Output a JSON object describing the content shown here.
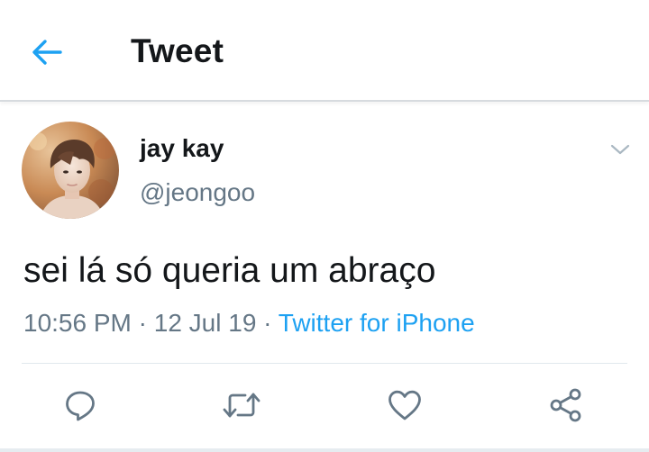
{
  "header": {
    "title": "Tweet",
    "back_icon": "arrow-left-icon"
  },
  "tweet": {
    "author_name": "jay kay",
    "author_handle": "@jeongoo",
    "text": "sei lá só queria um abraço",
    "time": "10:56 PM",
    "date": "12 Jul 19",
    "separator": "·",
    "source": "Twitter for iPhone",
    "more_icon": "chevron-down-icon"
  },
  "actions": [
    {
      "name": "reply",
      "icon": "reply-icon"
    },
    {
      "name": "retweet",
      "icon": "retweet-icon"
    },
    {
      "name": "like",
      "icon": "heart-icon"
    },
    {
      "name": "share",
      "icon": "share-icon"
    }
  ],
  "colors": {
    "accent": "#1da1f2",
    "text_primary": "#14171a",
    "text_secondary": "#657786",
    "divider": "#e1e8ed"
  }
}
